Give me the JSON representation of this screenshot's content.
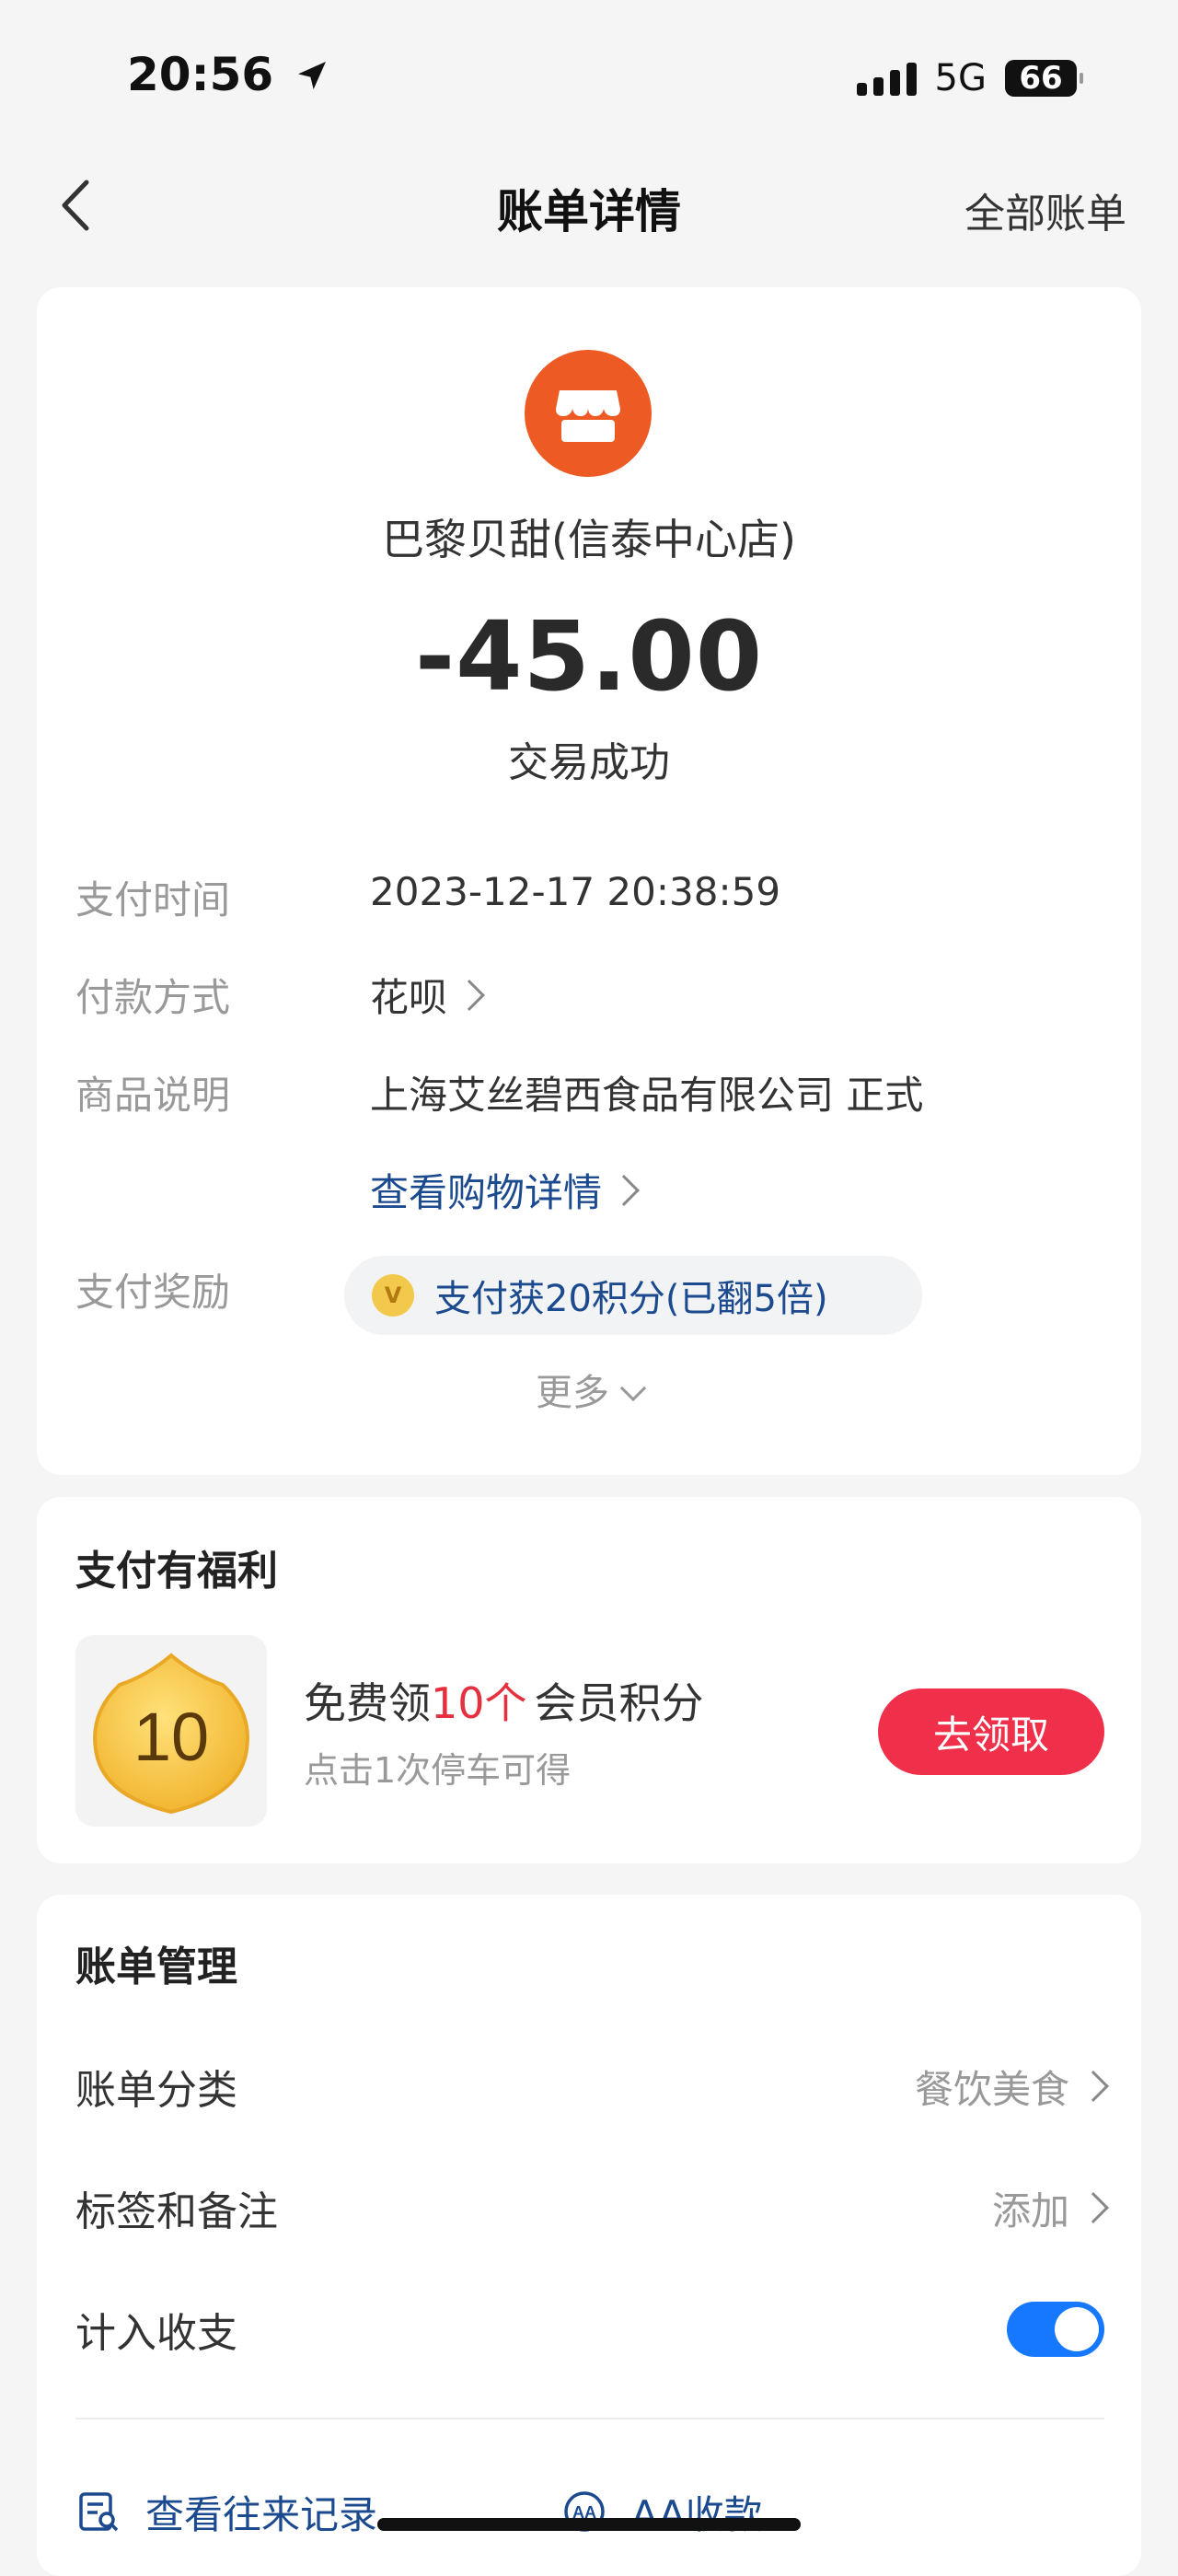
{
  "status_bar": {
    "time": "20:56",
    "network": "5G",
    "battery": "66"
  },
  "nav": {
    "title": "账单详情",
    "right_link": "全部账单"
  },
  "transaction": {
    "merchant": "巴黎贝甜(信泰中心店)",
    "amount": "-45.00",
    "status": "交易成功"
  },
  "details": {
    "pay_time_label": "支付时间",
    "pay_time_value": "2023-12-17 20:38:59",
    "pay_method_label": "付款方式",
    "pay_method_value": "花呗",
    "goods_label": "商品说明",
    "goods_value": "上海艾丝碧西食品有限公司 正式",
    "shopping_detail_link": "查看购物详情",
    "reward_label": "支付奖励",
    "reward_value": "支付获20积分(已翻5倍)",
    "more": "更多"
  },
  "benefit": {
    "title": "支付有福利",
    "coin_number": "10",
    "main_prefix": "免费领",
    "main_highlight": "10个",
    "main_suffix": "会员积分",
    "sub": "点击1次停车可得",
    "button": "去领取"
  },
  "manage": {
    "title": "账单管理",
    "category_label": "账单分类",
    "category_value": "餐饮美食",
    "tags_label": "标签和备注",
    "tags_value": "添加",
    "include_label": "计入收支",
    "include_on": true,
    "history_link": "查看往来记录",
    "aa_link": "AA收款"
  },
  "colors": {
    "accent_blue": "#1677ff",
    "link_blue": "#1b4a8f",
    "red": "#f0304a",
    "merchant_orange": "#ee5a24"
  }
}
